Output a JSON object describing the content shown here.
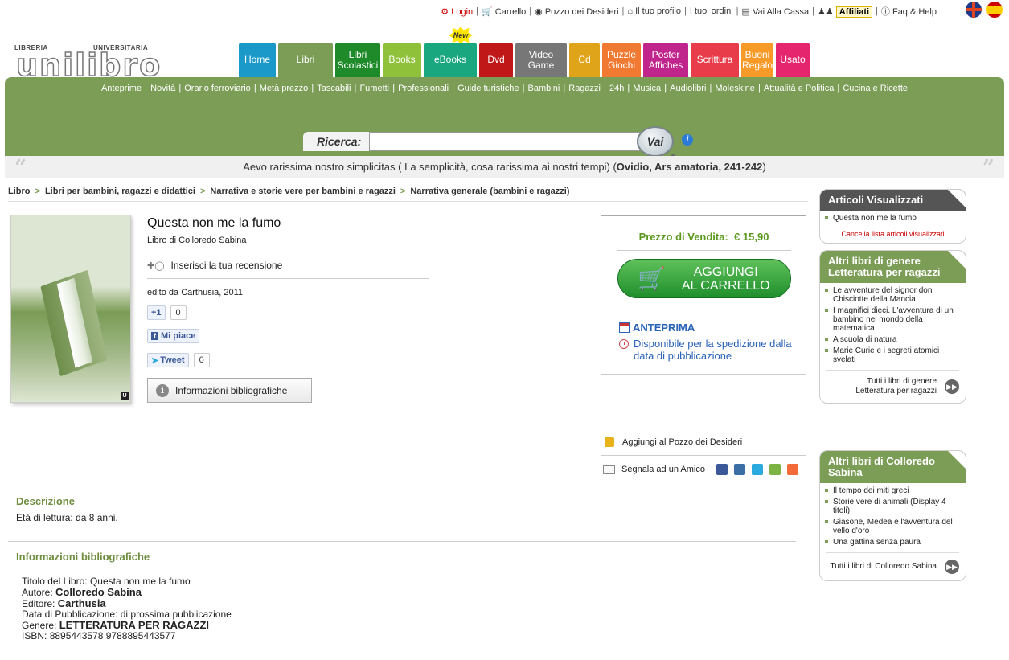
{
  "topbar": {
    "login": "Login",
    "carrello": "Carrello",
    "pozzo": "Pozzo dei Desideri",
    "profilo": "Il tuo profilo",
    "ordini": "I tuoi ordini",
    "cassa": "Vai Alla Cassa",
    "affiliati": "Affiliati",
    "faq": "Faq & Help"
  },
  "logo": {
    "left": "LIBRERIA",
    "right": "UNIVERSITARIA",
    "name": "unilibro"
  },
  "new_badge": "New",
  "tabs": [
    {
      "label": "Home",
      "color": "#1b9ac9",
      "w": 46
    },
    {
      "label": "Libri",
      "color": "#7b9d56",
      "w": 68
    },
    {
      "label": "Libri Scolastici",
      "color": "#1e8a2a",
      "w": 56
    },
    {
      "label": "Books",
      "color": "#8fc23a",
      "w": 48
    },
    {
      "label": "eBooks",
      "color": "#19a77f",
      "w": 66
    },
    {
      "label": "Dvd",
      "color": "#c01818",
      "w": 42
    },
    {
      "label": "Video Game",
      "color": "#777777",
      "w": 64
    },
    {
      "label": "Cd",
      "color": "#e0a41a",
      "w": 38
    },
    {
      "label": "Puzzle Giochi",
      "color": "#f07a32",
      "w": 48
    },
    {
      "label": "Poster Affiches",
      "color": "#c0258c",
      "w": 56
    },
    {
      "label": "Scrittura",
      "color": "#e83c4a",
      "w": 60
    },
    {
      "label": "Buoni Regalo",
      "color": "#f79a27",
      "w": 40
    },
    {
      "label": "Usato",
      "color": "#e5266f",
      "w": 42
    }
  ],
  "subnav": [
    "Anteprime",
    "Novità",
    "Orario ferroviario",
    "Metà prezzo",
    "Tascabili",
    "Fumetti",
    "Professionali",
    "Guide turistiche",
    "Bambini",
    "Ragazzi",
    "24h",
    "Musica",
    "Audiolibri",
    "Moleskine",
    "Attualità e Politica",
    "Cucina e Ricette"
  ],
  "search": {
    "label": "Ricerca:",
    "value": "",
    "button": "Vai"
  },
  "quote": {
    "text": "Aevo rarissima nostro simplicitas ( La semplicità, cosa rarissima ai nostri tempi) (",
    "source": "Ovidio, Ars amatoria, 241-242",
    "close": ")"
  },
  "breadcrumb": [
    "Libro",
    "Libri per bambini, ragazzi e didattici",
    "Narrativa e storie vere per bambini e ragazzi",
    "Narrativa generale (bambini e ragazzi)"
  ],
  "book": {
    "title": "Questa non me la fumo",
    "author_line": "Libro di Colloredo Sabina",
    "review": "Inserisci la tua recensione",
    "edito": "edito da Carthusia, 2011",
    "gplus": "+1",
    "gplus_count": "0",
    "like": "Mi piace",
    "tweet": "Tweet",
    "tweet_count": "0",
    "info_button": "Informazioni bibliografiche"
  },
  "purchase": {
    "price_label": "Prezzo di Vendita:",
    "price": "€ 15,90",
    "cart_line1": "AGGIUNGI",
    "cart_line2": "AL CARRELLO",
    "anteprima": "ANTEPRIMA",
    "disponibile": "Disponibile per la spedizione dalla data di pubblicazione",
    "pozzo": "Aggiungi al Pozzo dei Desideri",
    "segnala": "Segnala ad un Amico"
  },
  "descrizione": {
    "head": "Descrizione",
    "text": "Età di lettura: da 8 anni."
  },
  "bibliografia": {
    "head": "Informazioni bibliografiche",
    "titolo_label": "Titolo del Libro: ",
    "titolo": "Questa non me la fumo",
    "autore_label": "Autore: ",
    "autore": "Colloredo Sabina",
    "editore_label": "Editore: ",
    "editore": "Carthusia",
    "data_label": "Data di Pubblicazione: ",
    "data": "di prossima pubblicazione",
    "genere_label": "Genere: ",
    "genere": "LETTERATURA PER RAGAZZI",
    "isbn_label": "ISBN: ",
    "isbn": "8895443578 9788895443577"
  },
  "sidebar": {
    "visti": {
      "head": "Articoli Visualizzati",
      "items": [
        "Questa non me la fumo"
      ],
      "clear": "Cancella lista articoli visualizzati",
      "color": "#555555"
    },
    "genere": {
      "head": "Altri libri di genere Letteratura per ragazzi",
      "items": [
        "Le avventure del signor don Chisciotte della Mancia",
        "I magnifici dieci. L'avventura di un bambino nel mondo della matematica",
        "A scuola di natura",
        "Marie Curie e i segreti atomici svelati"
      ],
      "all": "Tutti i libri di genere Letteratura per ragazzi",
      "color": "#7b9d56"
    },
    "autore": {
      "head": "Altri libri di Colloredo Sabina",
      "items": [
        "Il tempo dei miti greci",
        "Storie vere di animali (Display 4 titoli)",
        "Giasone, Medea e l'avventura del vello d'oro",
        "Una gattina senza paura"
      ],
      "all": "Tutti i libri di Colloredo Sabina",
      "color": "#7b9d56"
    }
  }
}
